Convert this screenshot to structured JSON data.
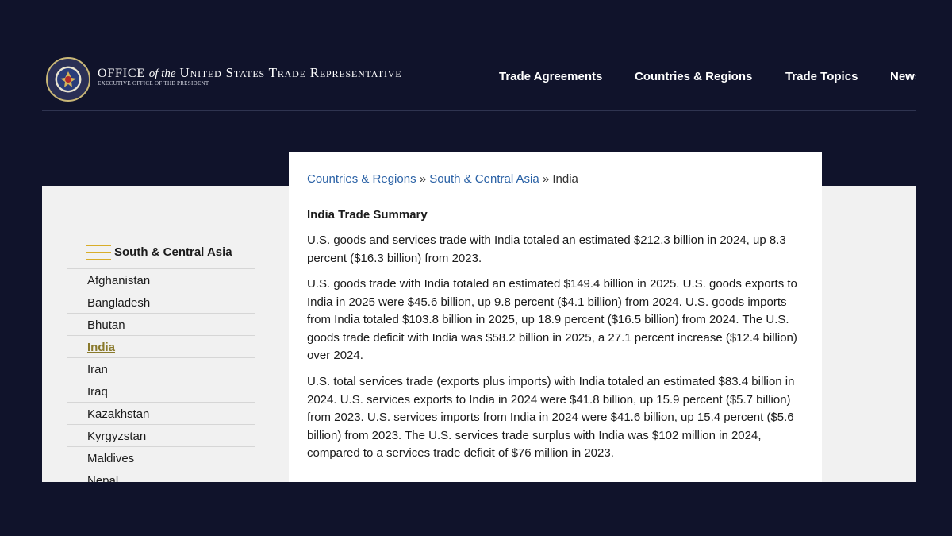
{
  "header": {
    "title_part1": "Office ",
    "title_ofthe": "of the",
    "title_part2": " United States Trade Representative",
    "subtitle": "EXECUTIVE OFFICE OF THE PRESIDENT",
    "nav": [
      "Trade Agreements",
      "Countries & Regions",
      "Trade Topics",
      "News"
    ]
  },
  "breadcrumb": {
    "level1": "Countries & Regions",
    "sep1": " » ",
    "level2": "South & Central Asia",
    "sep2": " » ",
    "current": "India"
  },
  "sidebar": {
    "heading": "South & Central Asia",
    "items": [
      {
        "label": "Afghanistan"
      },
      {
        "label": "Bangladesh"
      },
      {
        "label": "Bhutan"
      },
      {
        "label": "India",
        "active": true
      },
      {
        "label": "Iran"
      },
      {
        "label": "Iraq"
      },
      {
        "label": "Kazakhstan"
      },
      {
        "label": "Kyrgyzstan"
      },
      {
        "label": "Maldives"
      },
      {
        "label": "Nepal"
      }
    ]
  },
  "main": {
    "title": "India Trade Summary",
    "paragraphs": [
      "U.S. goods and services trade with India totaled an estimated $212.3 billion in 2024, up 8.3 percent ($16.3 billion) from 2023.",
      "U.S. goods trade with India totaled an estimated $149.4 billion in 2025. U.S. goods exports to India in 2025 were $45.6 billion, up 9.8 percent ($4.1 billion) from 2024. U.S. goods imports from India totaled $103.8 billion in 2025, up 18.9 percent ($16.5 billion) from 2024. The U.S. goods trade deficit with India was $58.2 billion in 2025, a 27.1 percent increase ($12.4 billion) over 2024.",
      "U.S. total services trade (exports plus imports) with India totaled an estimated $83.4 billion in 2024. U.S. services exports to India in 2024 were $41.8 billion, up 15.9 percent ($5.7 billion) from 2023. U.S. services imports from India in 2024 were $41.6 billion, up 15.4 percent ($5.6 billion) from 2023. The U.S. services trade surplus with India was $102 million in 2024, compared to a services trade deficit of $76 million in 2023."
    ]
  },
  "colors": {
    "page_bg": "#10132b",
    "link": "#2b62a6",
    "accent_gold": "#d8ad29",
    "active_item": "#8a7a2c",
    "content_bg": "#f1f1f1"
  },
  "icons": {
    "seal": "presidential-seal-icon",
    "menu": "hamburger-icon"
  }
}
